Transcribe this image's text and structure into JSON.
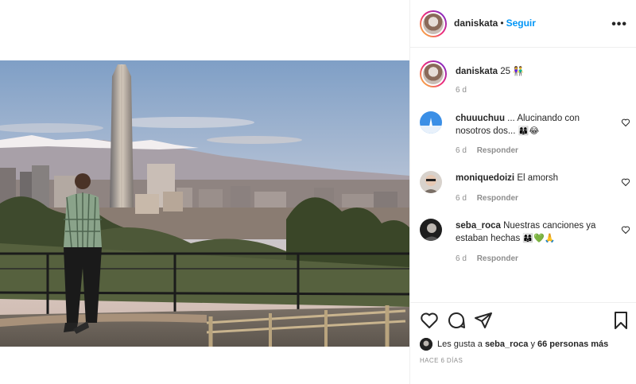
{
  "post": {
    "author": "daniskata",
    "follow_label": "Seguir",
    "separator": "•",
    "more_label": "•••"
  },
  "caption": {
    "username": "daniskata",
    "text": "25",
    "emoji": "👫",
    "time": "6 d"
  },
  "comments": [
    {
      "username": "chuuuchuu",
      "text": "... Alucinando con nosotros dos... ",
      "emoji": "👩‍👩‍👦😂",
      "time": "6 d",
      "reply": "Responder"
    },
    {
      "username": "moniquedoizi",
      "text": "El amorsh",
      "emoji": "",
      "time": "6 d",
      "reply": "Responder"
    },
    {
      "username": "seba_roca",
      "text": "Nuestras canciones ya estaban hechas ",
      "emoji": "👩‍👩‍👦💚🙏",
      "time": "6 d",
      "reply": "Responder"
    }
  ],
  "likes": {
    "prefix": "Les gusta a",
    "user": "seba_roca",
    "joiner": "y",
    "others": "66 personas más"
  },
  "date_label": "HACE 6 DÍAS",
  "icons": {
    "like": "heart-icon",
    "comment": "comment-icon",
    "share": "share-icon",
    "save": "bookmark-icon"
  },
  "colors": {
    "follow": "#0095f6",
    "meta": "#8e8e8e",
    "text": "#262626"
  }
}
